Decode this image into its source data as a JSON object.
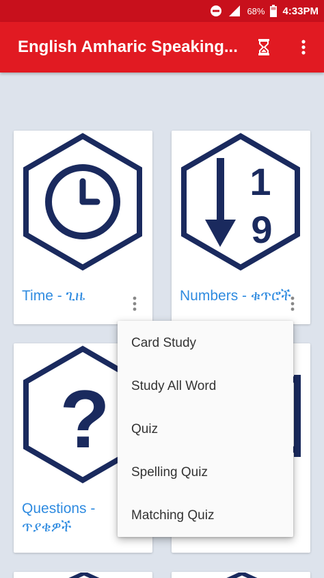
{
  "status_bar": {
    "battery": "68%",
    "time": "4:33PM",
    "icons": [
      "do-not-disturb-icon",
      "signal-icon",
      "battery-icon"
    ]
  },
  "app_bar": {
    "title": "English Amharic Speaking...",
    "icons": [
      "hourglass-icon",
      "more-vert-icon"
    ]
  },
  "cards": [
    {
      "label": "Time - ጊዜ",
      "icon": "clock-icon"
    },
    {
      "label": "Numbers - ቁጥሮች",
      "icon": "numbers-sort-icon"
    },
    {
      "label_line1": "Questions -",
      "label_line2": "ጥያቄዎች",
      "icon": "question-mark-icon"
    },
    {
      "label": "",
      "icon": "partial-hexagon-icon"
    }
  ],
  "context_menu": {
    "items": [
      "Card Study",
      "Study All Word",
      "Quiz",
      "Spelling Quiz",
      "Matching Quiz"
    ]
  },
  "colors": {
    "status_bar": "#c8101c",
    "app_bar": "#e11a22",
    "background": "#dde3ec",
    "icon_navy": "#1a2a5e",
    "label_blue": "#2f8be0"
  }
}
